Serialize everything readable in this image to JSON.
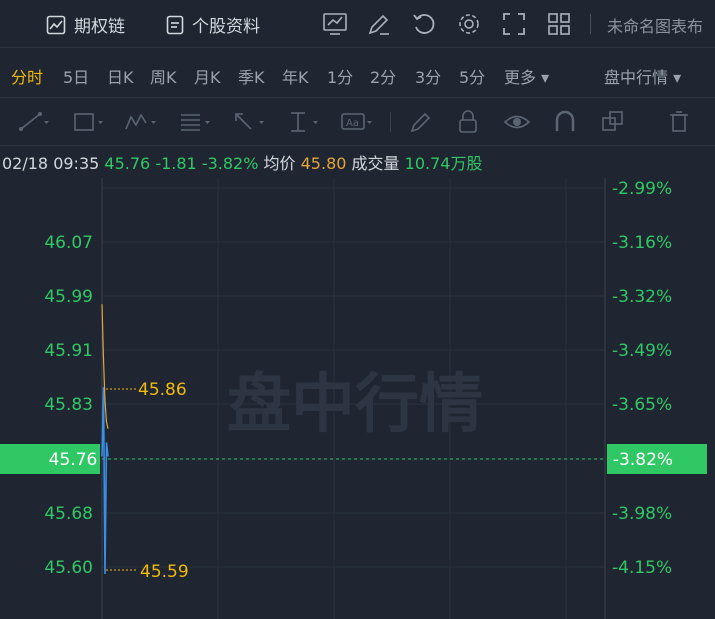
{
  "topbar": {
    "option_chain_label": "期权链",
    "stock_info_label": "个股资料",
    "chart_name": "未命名图表布"
  },
  "timeframes": [
    {
      "label": "分时",
      "active": true
    },
    {
      "label": "5日"
    },
    {
      "label": "日K"
    },
    {
      "label": "周K"
    },
    {
      "label": "月K"
    },
    {
      "label": "季K"
    },
    {
      "label": "年K"
    },
    {
      "label": "1分"
    },
    {
      "label": "2分"
    },
    {
      "label": "3分"
    },
    {
      "label": "5分"
    },
    {
      "label": "更多 ▾"
    }
  ],
  "session_label": "盘中行情 ▾",
  "quote": {
    "datetime": "02/18 09:35",
    "price": "45.76",
    "change": "-1.81",
    "change_pct": "-3.82%",
    "avg_label": "均价",
    "avg_value": "45.80",
    "volume_label": "成交量",
    "volume_value": "10.74万股"
  },
  "watermark": "盘中行情",
  "colors": {
    "down": "#2fc864",
    "accent": "#f0b90b",
    "price_line": "#3a8ee6",
    "avg_line": "#e2a43c"
  },
  "chart_data": {
    "type": "line",
    "y_ticks_left": [
      "46.07",
      "45.99",
      "45.91",
      "45.83",
      "45.76",
      "45.68",
      "45.60"
    ],
    "y_ticks_right": [
      "-2.99%",
      "-3.16%",
      "-3.32%",
      "-3.49%",
      "-3.65%",
      "-3.82%",
      "-3.98%",
      "-4.15%"
    ],
    "current_price_label": "45.76",
    "current_pct_label": "-3.82%",
    "high_marker": "45.86",
    "low_marker": "45.59",
    "ylim": [
      45.54,
      46.15
    ],
    "series": [
      {
        "x": [
          0,
          1,
          2,
          3,
          4
        ],
        "values": [
          45.76,
          45.86,
          45.59,
          45.78,
          45.76
        ]
      },
      {
        "x": [
          0,
          1,
          2,
          3,
          4
        ],
        "values": [
          45.98,
          45.9,
          45.84,
          45.81,
          45.8
        ]
      }
    ]
  }
}
